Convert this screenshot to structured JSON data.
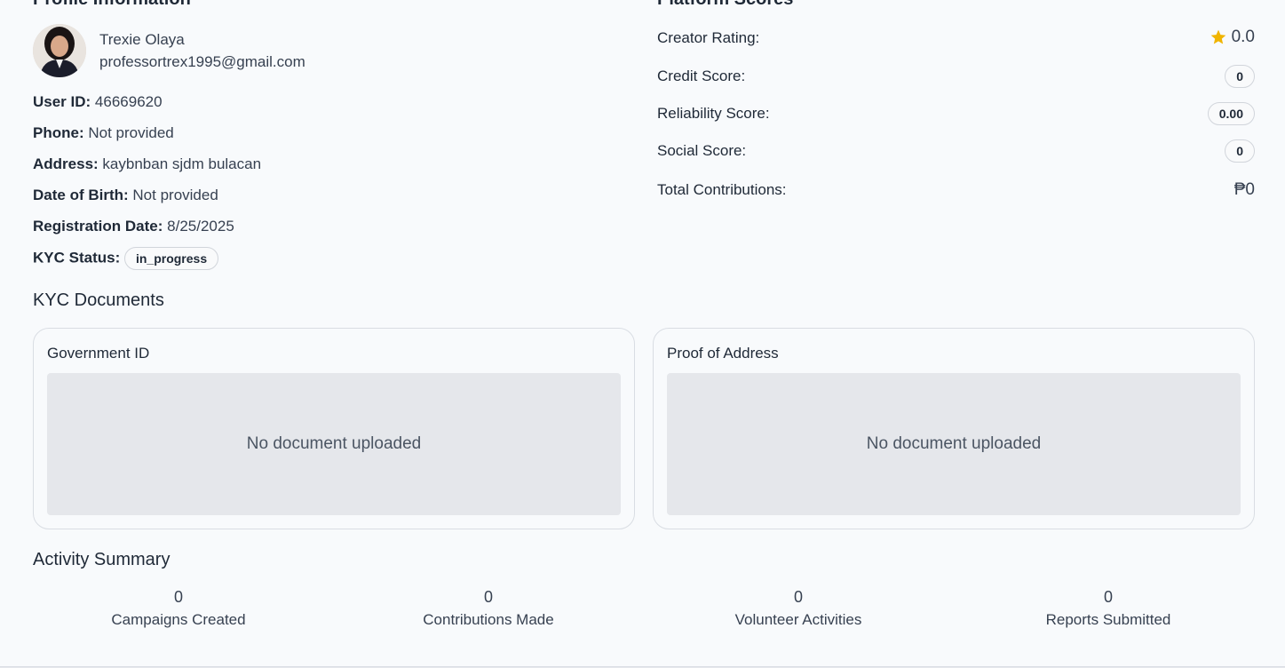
{
  "profile": {
    "section_title": "Profile Information",
    "name": "Trexie Olaya",
    "email": "professortrex1995@gmail.com",
    "user_id_label": "User ID:",
    "user_id": "46669620",
    "phone_label": "Phone:",
    "phone": "Not provided",
    "address_label": "Address:",
    "address": "kaybnban sjdm bulacan",
    "dob_label": "Date of Birth:",
    "dob": "Not provided",
    "registration_label": "Registration Date:",
    "registration": "8/25/2025",
    "kyc_label": "KYC Status:",
    "kyc_status": "in_progress"
  },
  "scores": {
    "section_title": "Platform Scores",
    "creator_rating_label": "Creator Rating:",
    "creator_rating": "0.0",
    "credit_label": "Credit Score:",
    "credit": "0",
    "reliability_label": "Reliability Score:",
    "reliability": "0.00",
    "social_label": "Social Score:",
    "social": "0",
    "total_label": "Total Contributions:",
    "total": "₱0"
  },
  "kyc_documents": {
    "section_title": "KYC Documents",
    "cards": [
      {
        "title": "Government ID",
        "placeholder": "No document uploaded"
      },
      {
        "title": "Proof of Address",
        "placeholder": "No document uploaded"
      }
    ]
  },
  "activity": {
    "section_title": "Activity Summary",
    "items": [
      {
        "value": "0",
        "label": "Campaigns Created"
      },
      {
        "value": "0",
        "label": "Contributions Made"
      },
      {
        "value": "0",
        "label": "Volunteer Activities"
      },
      {
        "value": "0",
        "label": "Reports Submitted"
      }
    ]
  },
  "colors": {
    "star": "#f0b400",
    "panel_bg": "#f8fafc",
    "doc_placeholder_bg": "#e5e7eb"
  }
}
